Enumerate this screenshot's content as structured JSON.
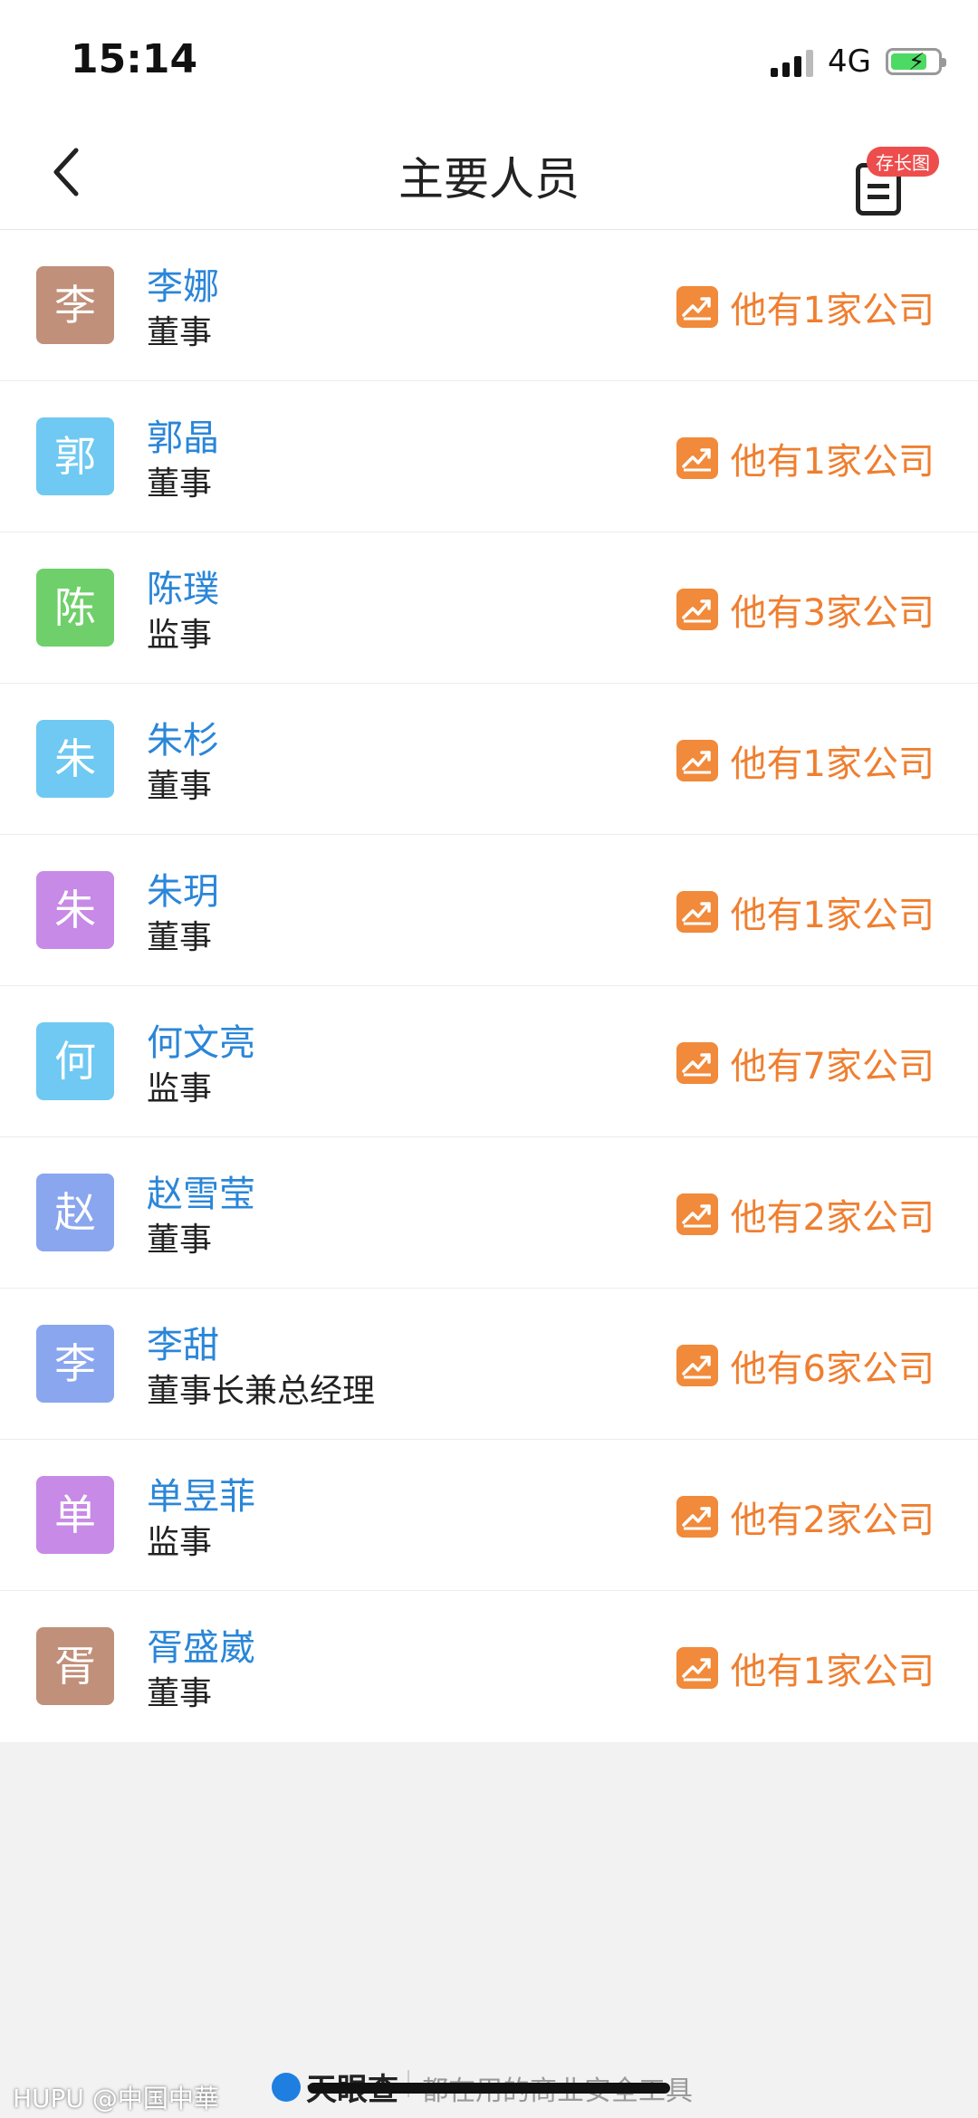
{
  "status_bar": {
    "time": "15:14",
    "network": "4G"
  },
  "nav": {
    "title": "主要人员",
    "back_icon": "chevron-left-icon",
    "longshot_badge": "存长图",
    "longshot_icon": "document-icon"
  },
  "people": [
    {
      "initial": "李",
      "name": "李娜",
      "role": "董事",
      "companies": "他有1家公司",
      "color": "#c0907a"
    },
    {
      "initial": "郭",
      "name": "郭晶",
      "role": "董事",
      "companies": "他有1家公司",
      "color": "#6fc9f2"
    },
    {
      "initial": "陈",
      "name": "陈璞",
      "role": "监事",
      "companies": "他有3家公司",
      "color": "#6fcf6a"
    },
    {
      "initial": "朱",
      "name": "朱杉",
      "role": "董事",
      "companies": "他有1家公司",
      "color": "#6fc9f2"
    },
    {
      "initial": "朱",
      "name": "朱玥",
      "role": "董事",
      "companies": "他有1家公司",
      "color": "#c78ae6"
    },
    {
      "initial": "何",
      "name": "何文亮",
      "role": "监事",
      "companies": "他有7家公司",
      "color": "#6fc9f2"
    },
    {
      "initial": "赵",
      "name": "赵雪莹",
      "role": "董事",
      "companies": "他有2家公司",
      "color": "#8aa6ee"
    },
    {
      "initial": "李",
      "name": "李甜",
      "role": "董事长兼总经理",
      "companies": "他有6家公司",
      "color": "#8aa6ee"
    },
    {
      "initial": "单",
      "name": "单昱菲",
      "role": "监事",
      "companies": "他有2家公司",
      "color": "#c78ae6"
    },
    {
      "initial": "胥",
      "name": "胥盛崴",
      "role": "董事",
      "companies": "他有1家公司",
      "color": "#c0907a"
    }
  ],
  "footer": {
    "brand": "天眼查",
    "slogan": "都在用的商业安全工具",
    "watermark": "HUPU @中国中華"
  },
  "colors": {
    "name_blue": "#2a86d8",
    "accent_orange": "#ef7f30"
  }
}
